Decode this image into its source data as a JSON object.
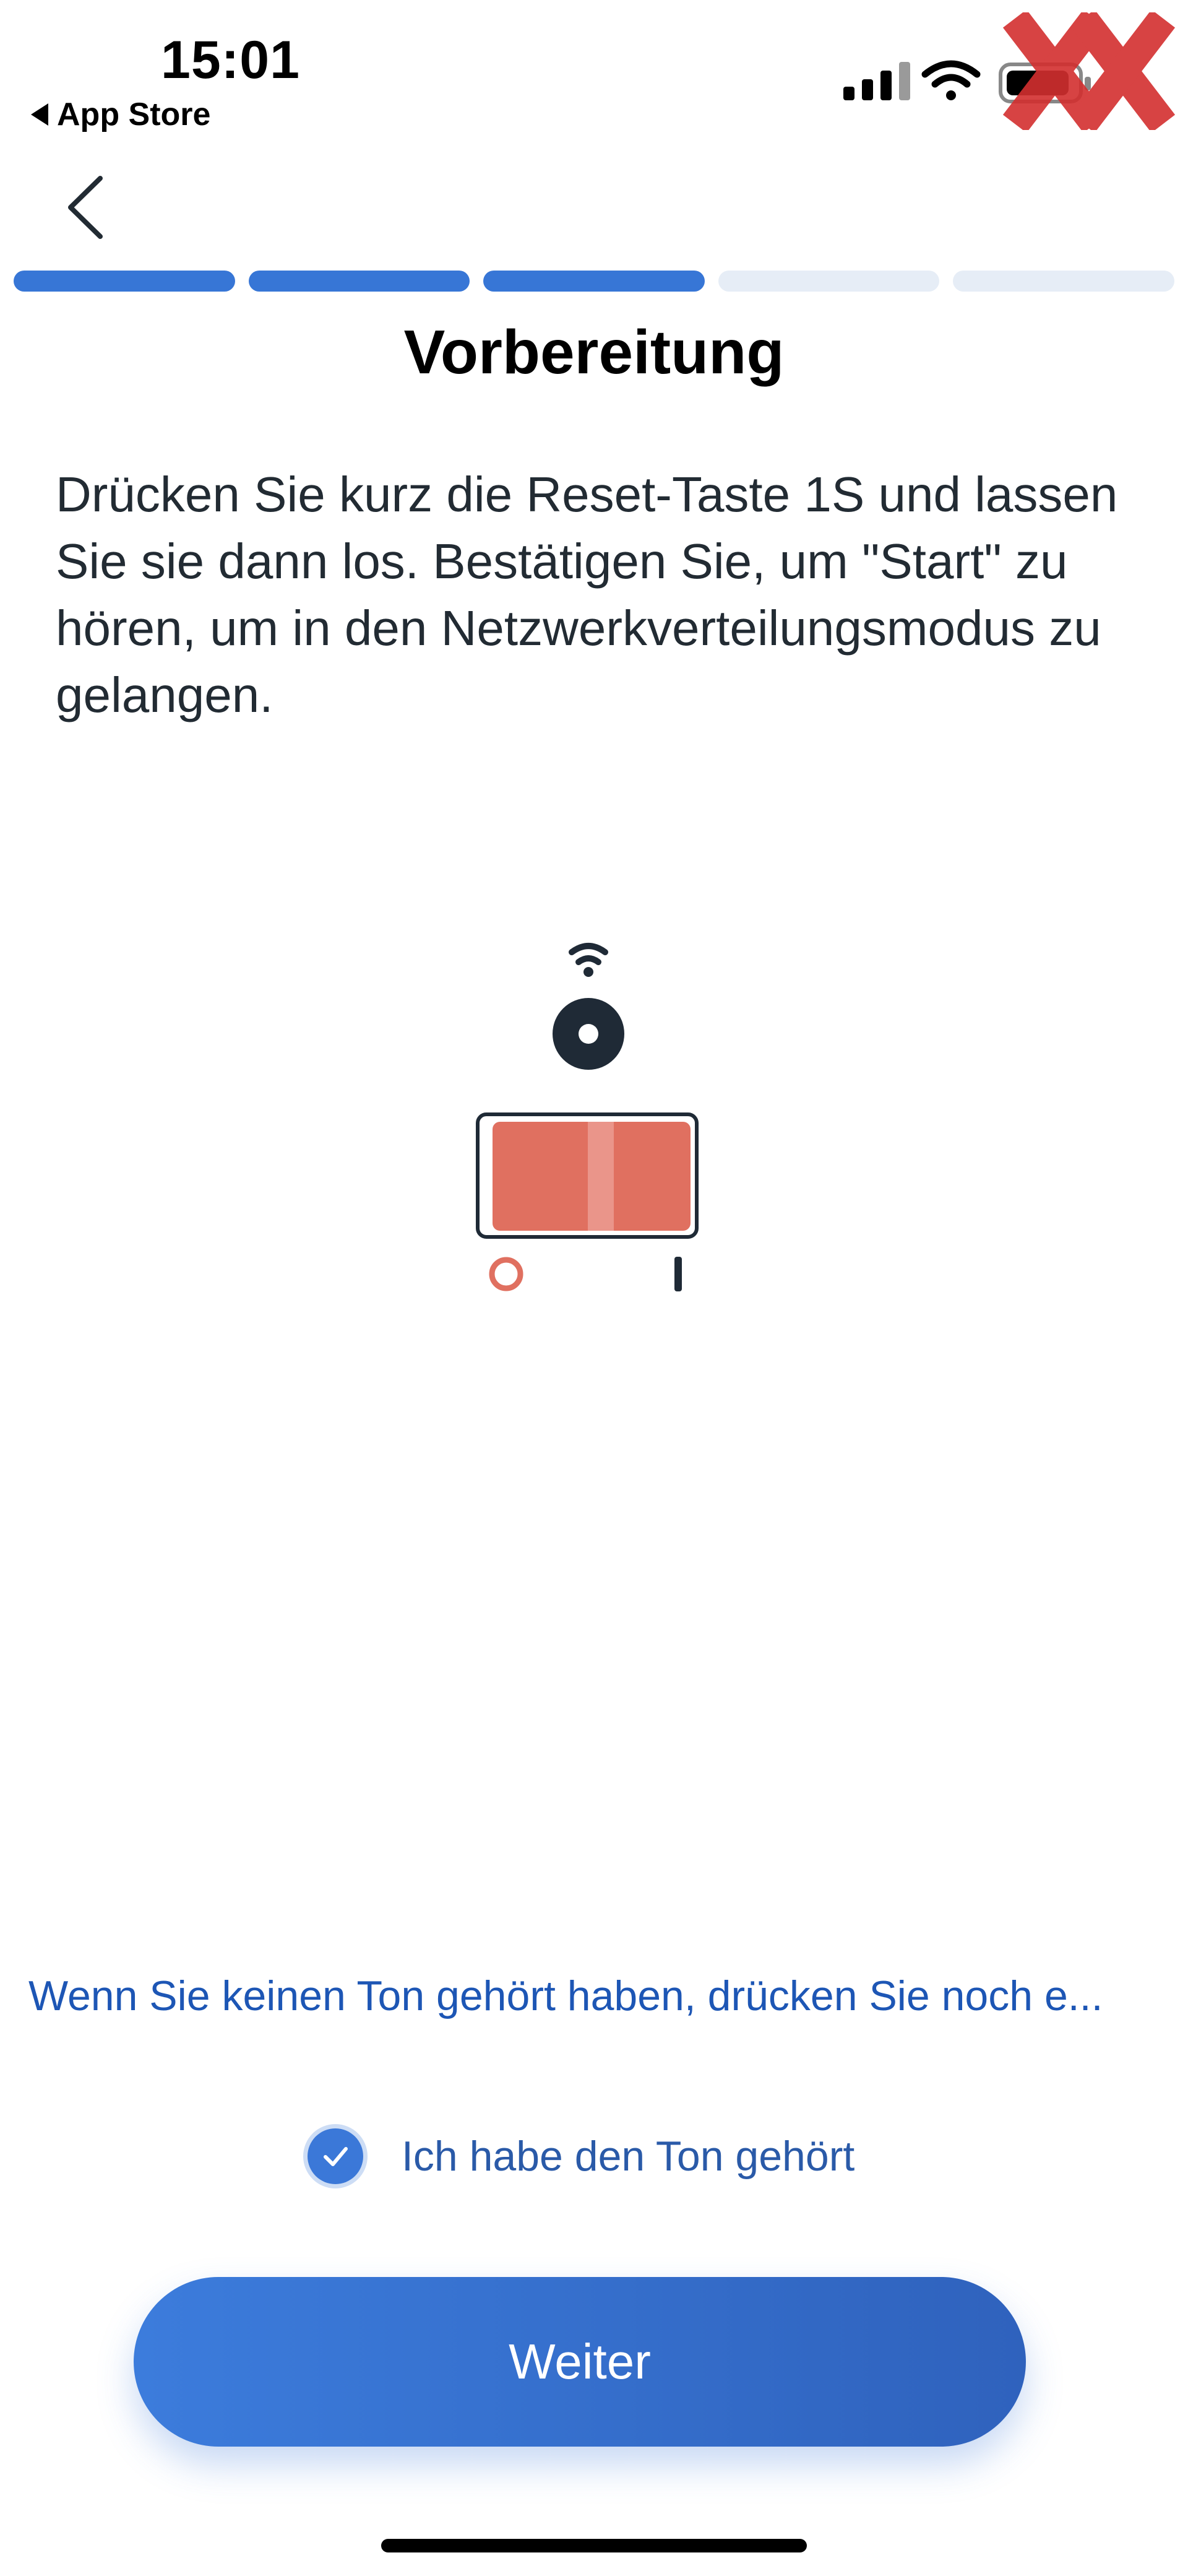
{
  "status_bar": {
    "time": "15:01",
    "back_app_label": "App Store",
    "icons": [
      "cellular-signal-icon",
      "wifi-icon",
      "battery-icon"
    ]
  },
  "watermark": {
    "text": "XX",
    "color": "#d32f2f"
  },
  "nav": {
    "back_icon": "chevron-left-icon"
  },
  "progress": {
    "total_steps": 5,
    "completed_steps": 3,
    "active_color": "#3776d6",
    "inactive_color": "#e6edf6"
  },
  "page": {
    "title": "Vorbereitung",
    "instruction": "Drücken Sie kurz die Reset-Taste 1S und lassen Sie sie dann los. Bestätigen Sie, um \"Start\" zu hören, um in den Netzwerkverteilungsmodus zu gelangen."
  },
  "illustration": {
    "icons": [
      "wifi-signal-icon",
      "reset-button-icon",
      "power-switch-icon"
    ],
    "switch_color": "#e07060"
  },
  "hint": {
    "text": "Wenn Sie keinen Ton gehört haben, drücken Sie noch e..."
  },
  "confirmation": {
    "label": "Ich habe den Ton gehört",
    "checked": true
  },
  "primary_button": {
    "label": "Weiter",
    "color": "#3776d6"
  }
}
